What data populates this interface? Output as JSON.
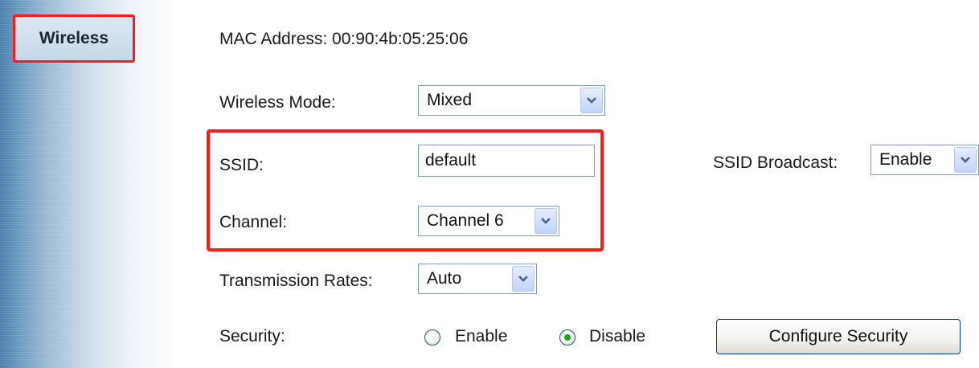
{
  "sidebar": {
    "active_tab": "Wireless"
  },
  "mac_address": {
    "text": "MAC Address: 00:90:4b:05:25:06"
  },
  "wireless_mode": {
    "label": "Wireless Mode:",
    "value": "Mixed"
  },
  "ssid": {
    "label": "SSID:",
    "value": "default"
  },
  "ssid_broadcast": {
    "label": "SSID Broadcast:",
    "value": "Enable"
  },
  "channel": {
    "label": "Channel:",
    "value": "Channel 6"
  },
  "transmission_rates": {
    "label": "Transmission Rates:",
    "value": "Auto"
  },
  "security": {
    "label": "Security:",
    "options": [
      {
        "label": "Enable",
        "checked": false
      },
      {
        "label": "Disable",
        "checked": true
      }
    ],
    "configure_button": "Configure Security"
  },
  "colors": {
    "highlight": "#ff1a1a",
    "radio_checked": "#21a121"
  },
  "icons": {
    "dropdown": "chevron-down-icon"
  }
}
